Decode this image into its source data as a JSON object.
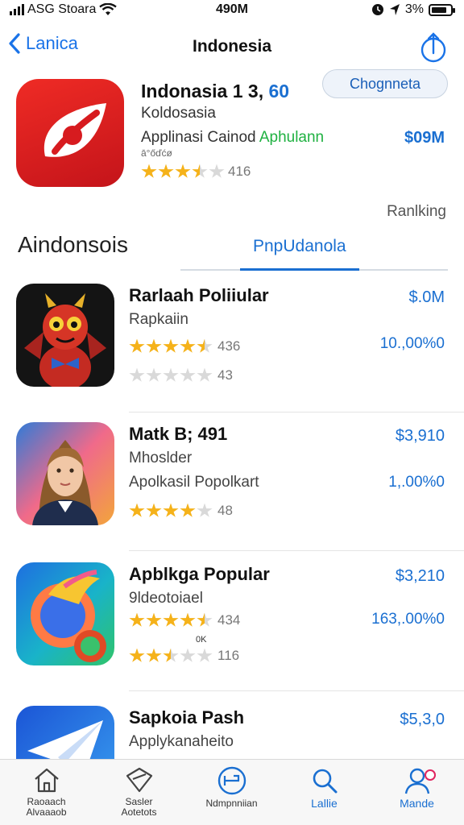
{
  "status_bar": {
    "carrier": "ASG Stoara",
    "time": "490M",
    "battery": "3%"
  },
  "nav": {
    "back_label": "Lanica",
    "title": "Indonesia"
  },
  "featured": {
    "name": "Indonasia 1 3,",
    "version": "60",
    "button_label": "Chognneta",
    "developer": "Koldosasia",
    "category_prefix": "Applinasi Cainod",
    "category_highlight": "Aphulann",
    "micro_label": "ā°őďćø",
    "rating_count": "416",
    "rating": 3.5,
    "price": "$09M"
  },
  "rankings_label": "Ranlking",
  "section_title": "Aindonsois",
  "segment_tab_label": "PnpUdanola",
  "apps": [
    {
      "title": "Rarlaah Poliiular",
      "subtitle": "Rapkaiin",
      "price": "$.0M",
      "percent": "10.,00%0",
      "rating_1": 4.5,
      "rating_1_count": "436",
      "rating_2": 0,
      "rating_2_count": "43"
    },
    {
      "title": "Matk B; 491",
      "subtitle": "Mhoslder",
      "line3": "Apolkasil Popolkart",
      "price": "$3,910",
      "percent": "1,.00%0",
      "rating_1": 4,
      "rating_1_count": "48"
    },
    {
      "title": "Apblkga Popular",
      "subtitle": "9ldeotoiael",
      "price": "$3,210",
      "percent": "163,.00%0",
      "rating_1": 4.5,
      "rating_1_count": "434",
      "rating_2": 2.5,
      "rating_2_count": "116",
      "micro": "0K"
    },
    {
      "title": "Sapkoia Pash",
      "subtitle": "Applykanaheito",
      "price": "$5,3,0"
    }
  ],
  "tabs": [
    {
      "label": "Raoaach\nAlvaaaob",
      "icon": "home-icon"
    },
    {
      "label": "Sasler\nAotetots",
      "icon": "apps-icon"
    },
    {
      "label": "Ndmpnniian",
      "icon": "updates-icon"
    },
    {
      "label": "Lallie",
      "icon": "search-icon"
    },
    {
      "label": "Mande",
      "icon": "profile-icon"
    }
  ],
  "colors": {
    "accent": "#1a6fd1",
    "star": "#f5b21a",
    "brand_red": "#e2231a",
    "green": "#1fb141"
  }
}
